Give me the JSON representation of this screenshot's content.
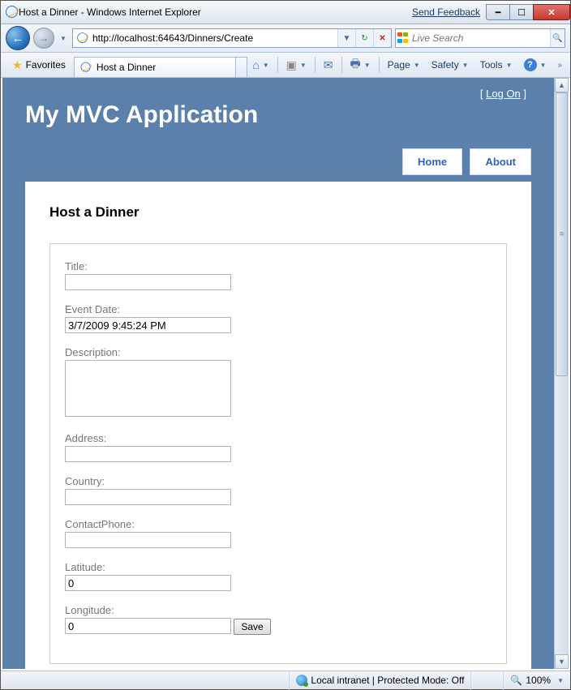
{
  "window": {
    "title": "Host a Dinner - Windows Internet Explorer",
    "feedback": "Send Feedback"
  },
  "nav": {
    "url": "http://localhost:64643/Dinners/Create",
    "search_placeholder": "Live Search"
  },
  "cmdbar": {
    "favorites": "Favorites",
    "tab_title": "Host a Dinner",
    "page": "Page",
    "safety": "Safety",
    "tools": "Tools"
  },
  "mvc": {
    "app_title": "My MVC Application",
    "logon": "Log On",
    "nav_home": "Home",
    "nav_about": "About",
    "page_heading": "Host a Dinner",
    "labels": {
      "title": "Title:",
      "eventdate": "Event Date:",
      "description": "Description:",
      "address": "Address:",
      "country": "Country:",
      "contactphone": "ContactPhone:",
      "latitude": "Latitude:",
      "longitude": "Longitude:"
    },
    "values": {
      "title": "",
      "eventdate": "3/7/2009 9:45:24 PM",
      "description": "",
      "address": "",
      "country": "",
      "contactphone": "",
      "latitude": "0",
      "longitude": "0"
    },
    "save": "Save"
  },
  "status": {
    "zone": "Local intranet | Protected Mode: Off",
    "zoom": "100%"
  }
}
